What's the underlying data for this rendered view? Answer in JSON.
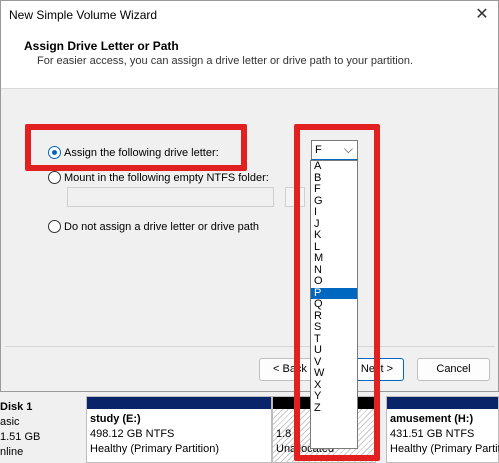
{
  "wizard": {
    "title": "New Simple Volume Wizard",
    "heading": "Assign Drive Letter or Path",
    "subheading": "For easier access, you can assign a drive letter or drive path to your partition.",
    "options": {
      "assign_letter": "Assign the following drive letter:",
      "mount_folder": "Mount in the following empty NTFS folder:",
      "no_assign": "Do not assign a drive letter or drive path"
    },
    "drive_letter": {
      "selected": "F",
      "highlighted": "P",
      "list": [
        "A",
        "B",
        "F",
        "G",
        "I",
        "J",
        "K",
        "L",
        "M",
        "N",
        "O",
        "P",
        "Q",
        "R",
        "S",
        "T",
        "U",
        "V",
        "W",
        "X",
        "Y",
        "Z"
      ]
    },
    "buttons": {
      "back": "< Back",
      "next": "Next >",
      "cancel": "Cancel"
    }
  },
  "background": {
    "left_fragments": [
      "S",
      "D"
    ],
    "left_status_fragment": "-",
    "disk": {
      "name": "Disk 1",
      "type": "asic",
      "size": "1.51 GB",
      "status": "nline"
    },
    "partitions": [
      {
        "name": "study  (E:)",
        "size": "498.12 GB NTFS",
        "status": "Healthy (Primary Partition)"
      },
      {
        "name": "",
        "size": "1.8",
        "status": "Unallocated"
      },
      {
        "name": "amusement  (H:)",
        "size": "431.51 GB NTFS",
        "status": "Healthy (Primary Partition)"
      }
    ]
  },
  "colors": {
    "accent": "#0067c0",
    "annotation": "#e32020",
    "partition_bar": "#0a246a"
  }
}
